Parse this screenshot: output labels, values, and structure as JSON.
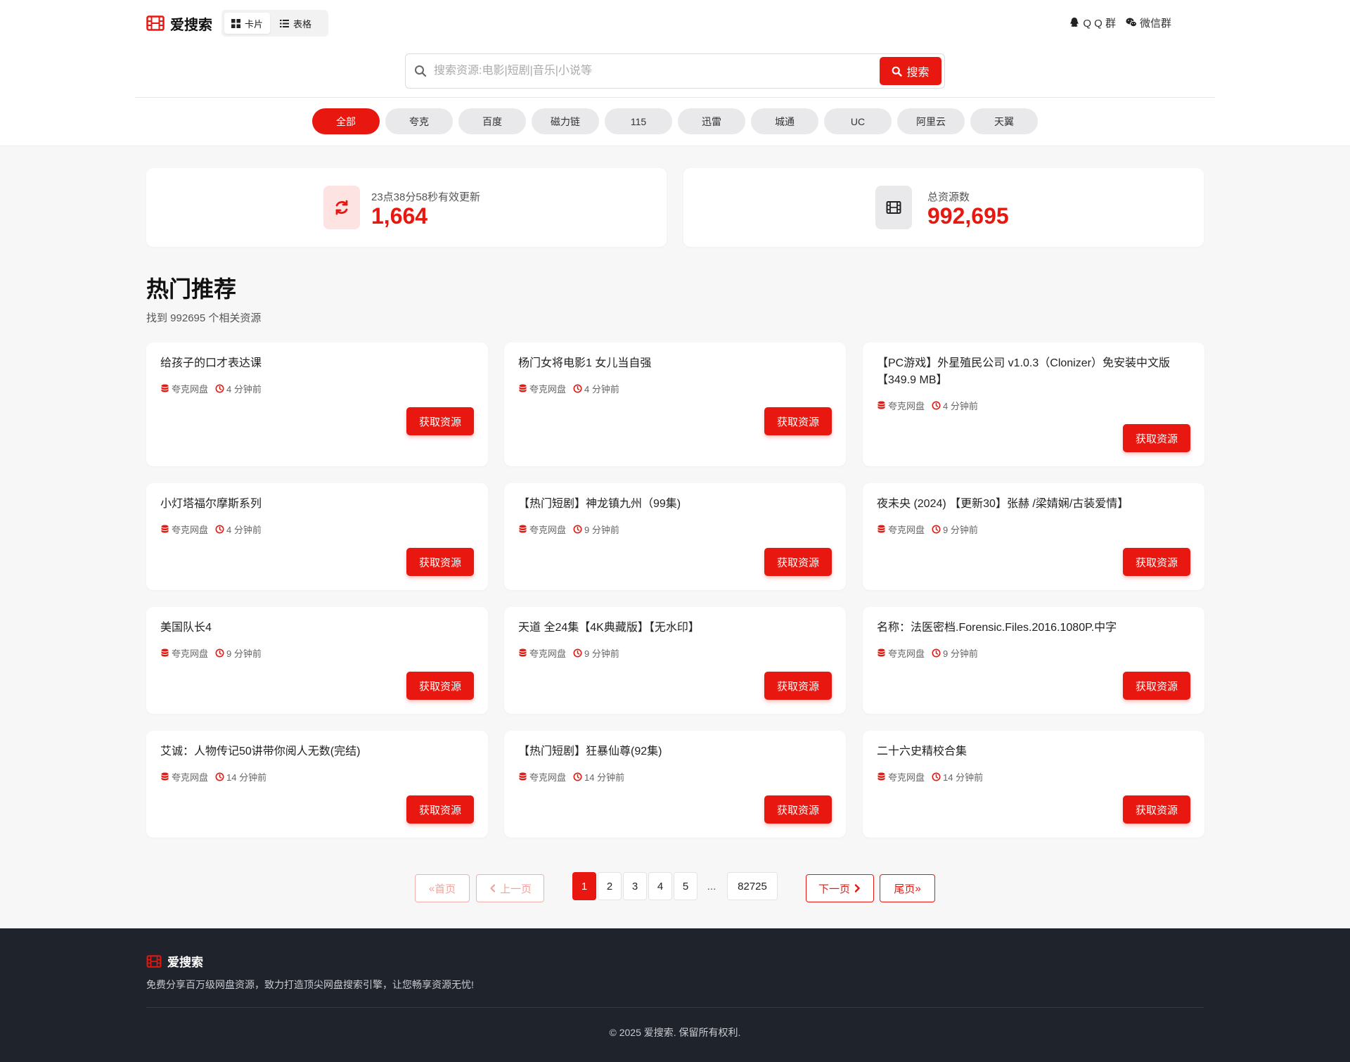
{
  "brand": {
    "name": "爱搜索"
  },
  "view_toggle": {
    "card": "卡片",
    "table": "表格"
  },
  "links": {
    "qq": "Q Q 群",
    "wechat": "微信群"
  },
  "search": {
    "placeholder": "搜索资源:电影|短剧|音乐|小说等",
    "value": "",
    "button": "搜索"
  },
  "categories": [
    "全部",
    "夸克",
    "百度",
    "磁力链",
    "115",
    "迅雷",
    "城通",
    "UC",
    "阿里云",
    "天翼"
  ],
  "stats": {
    "updated": {
      "label": "23点38分58秒有效更新",
      "value": "1,664"
    },
    "total": {
      "label": "总资源数",
      "value": "992,695"
    }
  },
  "section": {
    "title": "热门推荐",
    "subtitle": "找到 992695 个相关资源"
  },
  "get_button": "获取资源",
  "cards": [
    {
      "title": "给孩子的口才表达课",
      "source": "夸克网盘",
      "time": "4 分钟前"
    },
    {
      "title": "杨门女将电影1 女儿当自强",
      "source": "夸克网盘",
      "time": "4 分钟前"
    },
    {
      "title": "【PC游戏】外星殖民公司 v1.0.3（Clonizer）免安装中文版【349.9 MB】",
      "source": "夸克网盘",
      "time": "4 分钟前"
    },
    {
      "title": "小灯塔福尔摩斯系列",
      "source": "夸克网盘",
      "time": "4 分钟前"
    },
    {
      "title": "【热门短剧】神龙镇九州（99集)",
      "source": "夸克网盘",
      "time": "9 分钟前"
    },
    {
      "title": "夜未央 (2024) 【更新30】张赫 /梁婧娴/古装爱情】",
      "source": "夸克网盘",
      "time": "9 分钟前"
    },
    {
      "title": "美国队长4",
      "source": "夸克网盘",
      "time": "9 分钟前"
    },
    {
      "title": "天道 全24集【4K典藏版】【无水印】",
      "source": "夸克网盘",
      "time": "9 分钟前"
    },
    {
      "title": "名称：法医密档.Forensic.Files.2016.1080P.中字",
      "source": "夸克网盘",
      "time": "9 分钟前"
    },
    {
      "title": "艾诚：人物传记50讲带你阅人无数(完结)",
      "source": "夸克网盘",
      "time": "14 分钟前"
    },
    {
      "title": "【热门短剧】狂暴仙尊(92集)",
      "source": "夸克网盘",
      "time": "14 分钟前"
    },
    {
      "title": "二十六史精校合集",
      "source": "夸克网盘",
      "time": "14 分钟前"
    }
  ],
  "pagination": {
    "first": "首页",
    "prev": "上一页",
    "next": "下一页",
    "last": "尾页",
    "pages": [
      "1",
      "2",
      "3",
      "4",
      "5"
    ],
    "ellipsis": "...",
    "last_page": "82725",
    "current": "1"
  },
  "footer": {
    "name": "爱搜索",
    "description": "免费分享百万级网盘资源，致力打造顶尖网盘搜索引擎，让您畅享资源无忧!",
    "copyright": "© 2025 爱搜索. 保留所有权利."
  },
  "colors": {
    "accent": "#e8170f",
    "footer_bg": "#1f232b",
    "page_bg": "#f7f7f7"
  }
}
